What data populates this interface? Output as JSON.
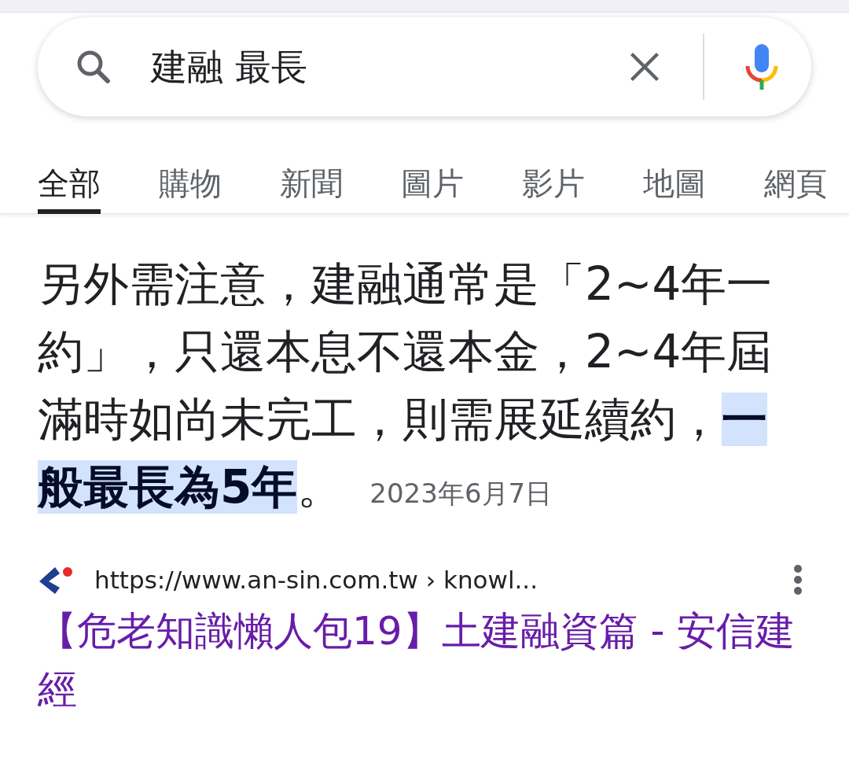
{
  "search": {
    "query": "建融 最長"
  },
  "tabs": [
    {
      "label": "全部",
      "selected": true
    },
    {
      "label": "購物",
      "selected": false
    },
    {
      "label": "新聞",
      "selected": false
    },
    {
      "label": "圖片",
      "selected": false
    },
    {
      "label": "影片",
      "selected": false
    },
    {
      "label": "地圖",
      "selected": false
    },
    {
      "label": "網頁",
      "selected": false
    }
  ],
  "snippet": {
    "text": "另外需注意，建融通常是「2~4年一約」，只還本息不還本金，2~4年屆滿時如尚未完工，則需展延續約，**一般最長為5年**。",
    "date": "2023年6月7日"
  },
  "result": {
    "url": "https://www.an-sin.com.tw › knowl...",
    "title": "【危老知識懶人包19】土建融資篇 - 安信建經"
  }
}
